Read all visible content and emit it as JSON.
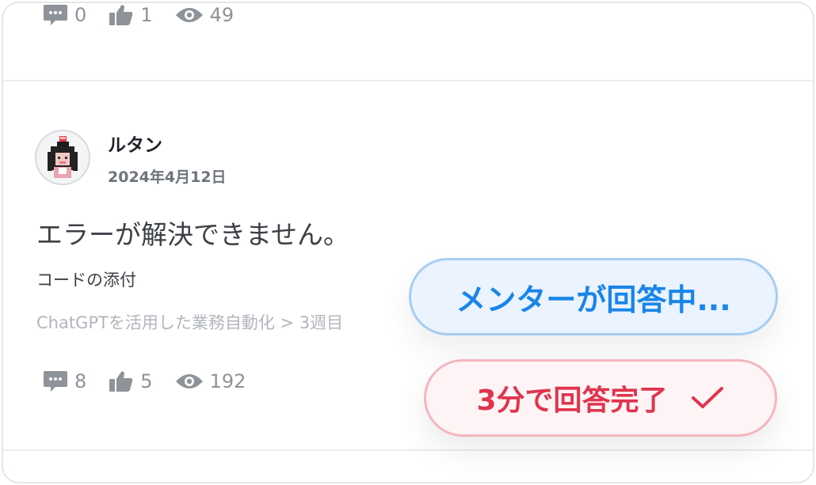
{
  "top_post": {
    "comments": "0",
    "likes": "1",
    "views": "49"
  },
  "post": {
    "username": "ルタン",
    "date": "2024年4月12日",
    "title": "エラーが解決できません。",
    "body": "コードの添付",
    "breadcrumb": "ChatGPTを活用した業務自動化 > 3週目",
    "comments": "8",
    "likes": "5",
    "views": "192"
  },
  "badges": {
    "mentor_answering": "メンターが回答中...",
    "answered": "3分で回答完了"
  },
  "icons": {
    "comment": "comment-icon",
    "like": "thumbs-up-icon",
    "view": "eye-icon",
    "check": "checkmark-icon"
  },
  "colors": {
    "mentor_text": "#1a85e8",
    "mentor_bg": "#eaf3ff",
    "answered_text": "#e0344d",
    "answered_bg": "#fff4f5",
    "meta_gray": "#8e9399"
  }
}
